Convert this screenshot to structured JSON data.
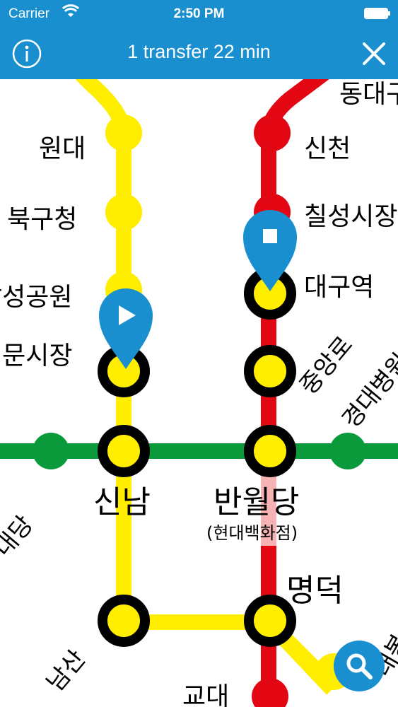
{
  "status_bar": {
    "carrier": "Carrier",
    "time": "2:50 PM"
  },
  "nav": {
    "title": "1 transfer 22 min",
    "info_icon": "info-icon",
    "close_icon": "close-icon"
  },
  "colors": {
    "header": "#1a8fd0",
    "line_yellow": "#ffee00",
    "line_red": "#e30613",
    "line_green": "#0a9a3c",
    "marker": "#1a8fd0"
  },
  "stations": {
    "dongdaegu": "동대구",
    "sincheon": "신천",
    "chilseong": "칠성시장",
    "daegu": "대구역",
    "jungangno": "중앙로",
    "gyeongdae": "경대병원",
    "wondae": "원대",
    "bukgu": "북구청",
    "dalseong": "달성공원",
    "seomun": "서문시장",
    "sinnam": "신남",
    "banwoldang": "반월당",
    "banwoldang_sub": "(현대백화점)",
    "naedang": "내당",
    "myeongdeok": "명덕",
    "namsan": "남산",
    "gyodae": "교대",
    "bottom_right": "대봉"
  },
  "search_icon": "search-icon"
}
